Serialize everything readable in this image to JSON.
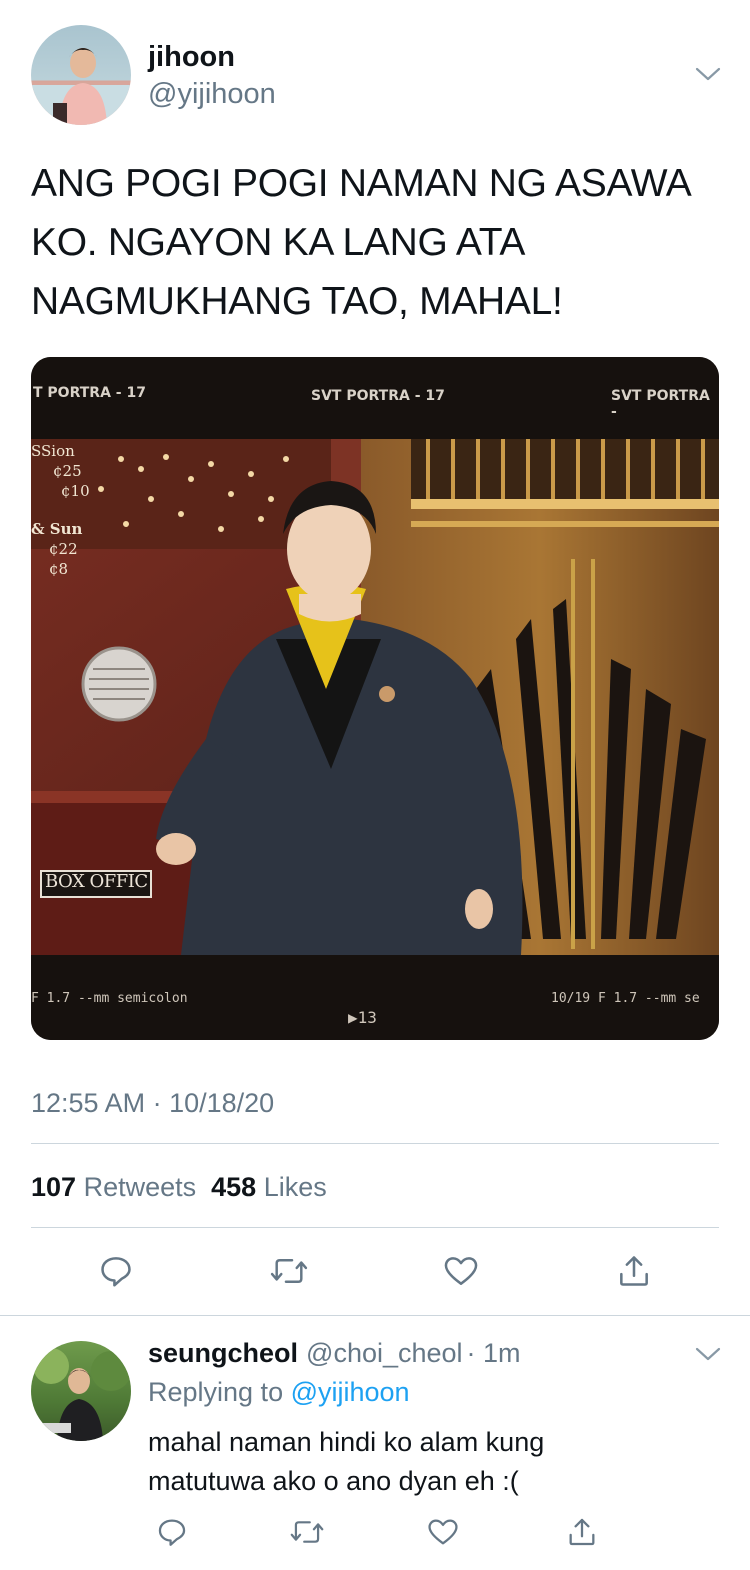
{
  "tweet": {
    "author_name": "jihoon",
    "author_handle": "@yijihoon",
    "text_lines": [
      "ANG POGI POGI NAMAN NG ASAWA",
      "KO. NGAYON KA LANG ATA",
      "NAGMUKHANG TAO, MAHAL!"
    ],
    "timestamp": "12:55 AM · 10/18/20",
    "retweets_count": "107",
    "retweets_label": "Retweets",
    "likes_count": "458",
    "likes_label": "Likes",
    "photo": {
      "film_top_left": "T PORTRA - 17",
      "film_top_center": "SVT PORTRA - 17",
      "film_top_right": "SVT PORTRA -",
      "film_bottom_left": "F 1.7 --mm semicolon",
      "film_bottom_center": "▶13",
      "film_bottom_right": "10/19 F 1.7 --mm se",
      "sign_lines": [
        "SSion",
        "¢25",
        "¢10",
        "& Sun",
        "¢22",
        "¢8"
      ],
      "box_office": "BOX OFFIC"
    }
  },
  "reply": {
    "author_name": "seungcheol",
    "author_handle": "@choi_cheol",
    "time": "· 1m",
    "replying_prefix": "Replying to",
    "replying_handle": "@yijihoon",
    "text_lines": [
      "mahal naman hindi ko alam kung",
      "matutuwa ako o ano dyan eh :("
    ]
  },
  "icons": {
    "reply": "reply-icon",
    "retweet": "retweet-icon",
    "like": "heart-icon",
    "share": "share-icon",
    "more": "chevron-down-icon"
  },
  "colors": {
    "text": "#0f1419",
    "secondary": "#657786",
    "link": "#1da1f2",
    "divider": "#ccd6dd"
  }
}
